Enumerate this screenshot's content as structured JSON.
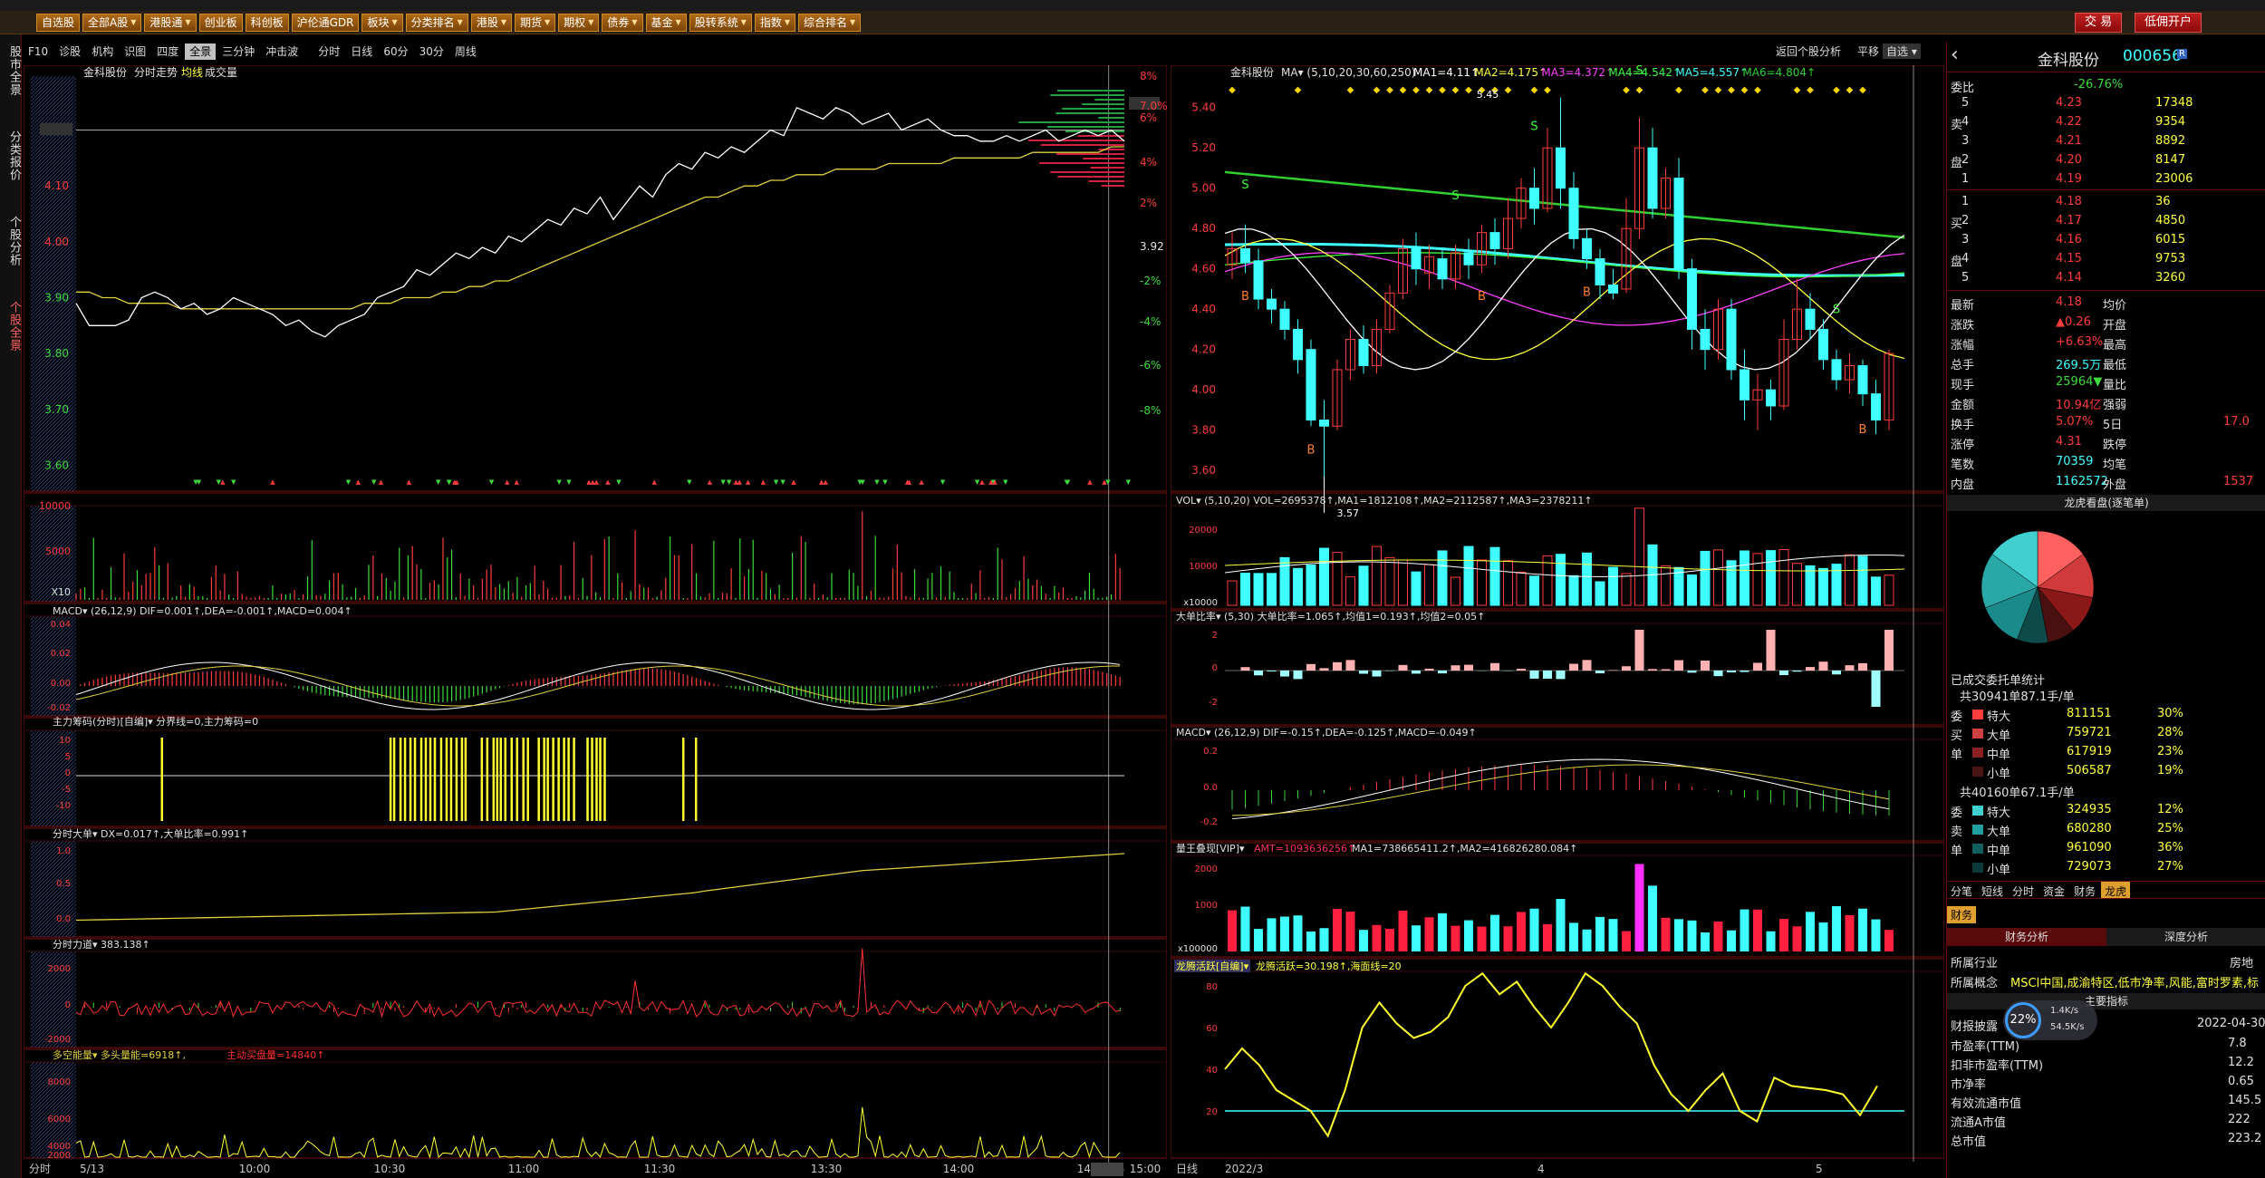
{
  "menu": {
    "items": [
      "自选股",
      "全部A股",
      "港股通",
      "创业板",
      "科创板",
      "沪伦通GDR",
      "板块",
      "分类排名",
      "港股",
      "期货",
      "期权",
      "债券",
      "基金",
      "股转系统",
      "指数",
      "综合排名"
    ],
    "withArrow": [
      false,
      true,
      true,
      false,
      false,
      false,
      true,
      true,
      true,
      true,
      true,
      true,
      true,
      true,
      true,
      true
    ],
    "trade": "交 易",
    "account": "低佣开户"
  },
  "lefttabs": [
    "股市全景",
    "分类报价",
    "个股分析",
    "个股全景"
  ],
  "subbar": {
    "items": [
      "F10",
      "诊股",
      "机构",
      "识图",
      "四度",
      "全景",
      "三分钟",
      "冲击波",
      "分时",
      "日线",
      "60分",
      "30分",
      "周线"
    ],
    "right_link": "返回个股分析",
    "right_b": "平移",
    "right_c": "自选"
  },
  "intraday": {
    "title": "金科股份",
    "mode": "分时走势",
    "avg": "均线",
    "vol": "成交量",
    "price_ticks": [
      "4.20",
      "4.10",
      "4.00",
      "3.90",
      "3.80",
      "3.70",
      "3.60"
    ],
    "pct_ticks": [
      "8%",
      "7.0%",
      "6%",
      "4%",
      "2%",
      "3.92",
      "-2%",
      "-4%",
      "-6%",
      "-8%"
    ],
    "price_line": [
      3.89,
      3.85,
      3.85,
      3.85,
      3.86,
      3.9,
      3.91,
      3.9,
      3.88,
      3.89,
      3.87,
      3.88,
      3.9,
      3.89,
      3.88,
      3.87,
      3.85,
      3.86,
      3.84,
      3.83,
      3.85,
      3.86,
      3.87,
      3.9,
      3.91,
      3.92,
      3.95,
      3.94,
      3.96,
      3.98,
      3.97,
      3.99,
      3.98,
      4.01,
      4.0,
      4.02,
      4.04,
      4.03,
      4.06,
      4.05,
      4.08,
      4.04,
      4.07,
      4.1,
      4.08,
      4.12,
      4.14,
      4.13,
      4.16,
      4.15,
      4.17,
      4.16,
      4.18,
      4.2,
      4.19,
      4.24,
      4.23,
      4.22,
      4.24,
      4.23,
      4.21,
      4.22,
      4.23,
      4.2,
      4.21,
      4.22,
      4.2,
      4.19,
      4.19,
      4.18,
      4.18,
      4.19,
      4.18,
      4.19,
      4.2,
      4.18,
      4.19,
      4.2,
      4.19,
      4.2,
      4.18
    ],
    "avg_line": [
      3.91,
      3.91,
      3.9,
      3.9,
      3.89,
      3.89,
      3.89,
      3.89,
      3.88,
      3.88,
      3.88,
      3.88,
      3.88,
      3.88,
      3.88,
      3.88,
      3.88,
      3.88,
      3.88,
      3.88,
      3.88,
      3.88,
      3.89,
      3.89,
      3.89,
      3.9,
      3.9,
      3.9,
      3.91,
      3.91,
      3.92,
      3.92,
      3.93,
      3.93,
      3.94,
      3.95,
      3.96,
      3.97,
      3.98,
      3.99,
      4.0,
      4.01,
      4.02,
      4.03,
      4.04,
      4.05,
      4.06,
      4.07,
      4.08,
      4.08,
      4.09,
      4.1,
      4.1,
      4.11,
      4.11,
      4.12,
      4.12,
      4.12,
      4.13,
      4.13,
      4.13,
      4.13,
      4.14,
      4.14,
      4.14,
      4.14,
      4.14,
      4.15,
      4.15,
      4.15,
      4.15,
      4.15,
      4.15,
      4.16,
      4.16,
      4.16,
      4.16,
      4.16,
      4.16,
      4.17,
      4.17
    ],
    "cur_price": "4.20",
    "vol_ticks": [
      "10000",
      "5000",
      "X10"
    ],
    "macd_label": "MACD▾  (26,12,9)  DIF=0.001↑,DEA=-0.001↑,MACD=0.004↑",
    "macd_ticks": [
      "0.04",
      "0.02",
      "0.00",
      "-0.02"
    ],
    "zlcm_label": "主力筹码(分时)[自编]▾  分界线=0,主力筹码=0",
    "zlcm_ticks": [
      "10",
      "5",
      "0",
      "-5",
      "-10"
    ],
    "dd_label": "分时大单▾  DX=0.017↑,大单比率=0.991↑",
    "dd_ticks": [
      "1.0",
      "0.5",
      "0.0"
    ],
    "ld_label": "分时力道▾  383.138↑",
    "ld_ticks": [
      "2000",
      "0",
      "-2000"
    ],
    "dk_label": "多空能量▾  多头量能=6918↑,",
    "dk_label2": "主动买盘量=14840↑",
    "dk_ticks": [
      "8000",
      "6000",
      "4000",
      "2000"
    ],
    "time_axis": [
      "5/13",
      "10:00",
      "10:30",
      "11:00",
      "11:30",
      "13:30",
      "14:00",
      "14:30",
      "14:53",
      "15:00"
    ],
    "bottom_left": "分时"
  },
  "kline": {
    "title": "金科股份",
    "ma_label": "MA▾  (5,10,20,30,60,250)",
    "ma_values": [
      "MA1=4.11↑",
      "MA2=4.175↑",
      "MA3=4.372↑",
      "MA4=4.542↑",
      "MA5=4.557↑",
      "MA6=4.804↑"
    ],
    "ma_colors": [
      "#ffffff",
      "#ffff40",
      "#ff40ff",
      "#40ff40",
      "#40ffff",
      "#30d030"
    ],
    "price_ticks": [
      "5.40",
      "5.20",
      "5.00",
      "4.80",
      "4.60",
      "4.40",
      "4.20",
      "4.00",
      "3.80",
      "3.60"
    ],
    "high_label": "5.45",
    "low_label": "3.57",
    "candles": [
      [
        4.62,
        4.7,
        4.55,
        4.78
      ],
      [
        4.7,
        4.63,
        4.58,
        4.82
      ],
      [
        4.64,
        4.45,
        4.4,
        4.7
      ],
      [
        4.45,
        4.4,
        4.33,
        4.5
      ],
      [
        4.4,
        4.3,
        4.25,
        4.44
      ],
      [
        4.3,
        4.15,
        4.08,
        4.35
      ],
      [
        4.2,
        3.85,
        3.82,
        4.25
      ],
      [
        3.85,
        3.82,
        3.57,
        3.95
      ],
      [
        3.82,
        4.1,
        3.8,
        4.15
      ],
      [
        4.1,
        4.25,
        4.05,
        4.3
      ],
      [
        4.25,
        4.12,
        4.08,
        4.32
      ],
      [
        4.12,
        4.3,
        4.08,
        4.35
      ],
      [
        4.3,
        4.48,
        4.28,
        4.52
      ],
      [
        4.48,
        4.7,
        4.45,
        4.75
      ],
      [
        4.7,
        4.6,
        4.52,
        4.78
      ],
      [
        4.58,
        4.66,
        4.5,
        4.72
      ],
      [
        4.65,
        4.55,
        4.5,
        4.7
      ],
      [
        4.55,
        4.68,
        4.5,
        4.72
      ],
      [
        4.68,
        4.62,
        4.55,
        4.75
      ],
      [
        4.62,
        4.78,
        4.58,
        4.82
      ],
      [
        4.78,
        4.7,
        4.62,
        4.85
      ],
      [
        4.7,
        4.85,
        4.65,
        4.95
      ],
      [
        4.85,
        5.0,
        4.8,
        5.05
      ],
      [
        5.0,
        4.9,
        4.82,
        5.1
      ],
      [
        4.9,
        5.2,
        4.88,
        5.3
      ],
      [
        5.2,
        5.0,
        4.9,
        5.45
      ],
      [
        5.0,
        4.75,
        4.7,
        5.08
      ],
      [
        4.75,
        4.65,
        4.6,
        4.8
      ],
      [
        4.65,
        4.52,
        4.45,
        4.7
      ],
      [
        4.52,
        4.48,
        4.45,
        4.6
      ],
      [
        4.5,
        4.8,
        4.48,
        4.95
      ],
      [
        4.8,
        5.2,
        4.75,
        5.35
      ],
      [
        5.2,
        4.9,
        4.85,
        5.3
      ],
      [
        4.9,
        5.05,
        4.85,
        5.1
      ],
      [
        5.05,
        4.6,
        4.55,
        5.15
      ],
      [
        4.6,
        4.3,
        4.2,
        4.65
      ],
      [
        4.3,
        4.2,
        4.1,
        4.4
      ],
      [
        4.2,
        4.4,
        4.15,
        4.45
      ],
      [
        4.4,
        4.1,
        4.05,
        4.45
      ],
      [
        4.1,
        3.95,
        3.85,
        4.2
      ],
      [
        3.95,
        4.0,
        3.8,
        4.08
      ],
      [
        4.0,
        3.92,
        3.85,
        4.05
      ],
      [
        3.92,
        4.25,
        3.9,
        4.35
      ],
      [
        4.25,
        4.4,
        4.2,
        4.55
      ],
      [
        4.4,
        4.3,
        4.25,
        4.48
      ],
      [
        4.3,
        4.15,
        4.1,
        4.35
      ],
      [
        4.15,
        4.05,
        4.0,
        4.2
      ],
      [
        4.05,
        4.12,
        3.98,
        4.18
      ],
      [
        4.12,
        3.98,
        3.92,
        4.15
      ],
      [
        3.98,
        3.85,
        3.78,
        4.05
      ],
      [
        3.85,
        4.18,
        3.8,
        4.2
      ]
    ],
    "vol_label": "VOL▾  (5,10,20)  VOL=2695378↑,MA1=1812108↑,MA2=2112587↑,MA3=2378211↑",
    "vol_ticks": [
      "20000",
      "10000",
      "x10000"
    ],
    "ddbl_label": "大单比率▾  (5,30)  大单比率=1.065↑,均值1=0.193↑,均值2=0.05↑",
    "ddbl_ticks": [
      "2",
      "0",
      "-2"
    ],
    "macd_label": "MACD▾  (26,12,9)  DIF=-0.15↑,DEA=-0.125↑,MACD=-0.049↑",
    "macd_ticks": [
      "0.2",
      "0.0",
      "-0.2"
    ],
    "lwdx_label": "量王叠现[VIP]▾",
    "lwdx_amt": "AMT=1093636256↑",
    "lwdx_rest": "MA1=738665411.2↑,MA2=416826280.084↑",
    "lwdx_ticks": [
      "2000",
      "1000",
      "x100000"
    ],
    "lthy_label": "龙腾活跃[自编]▾",
    "lthy_rest": "龙腾活跃=30.198↑,海面线=20",
    "lthy_ticks": [
      "80",
      "60",
      "40",
      "20"
    ],
    "lthy_values": [
      40,
      50,
      42,
      30,
      25,
      20,
      8,
      30,
      60,
      72,
      62,
      55,
      58,
      65,
      80,
      86,
      76,
      82,
      70,
      60,
      72,
      86,
      80,
      70,
      62,
      42,
      28,
      20,
      30,
      38,
      20,
      15,
      36,
      32,
      31,
      30,
      28,
      18,
      32
    ],
    "time_axis": [
      "2022/3",
      "4",
      "5"
    ],
    "bottom_left": "日线"
  },
  "quote": {
    "name": "金科股份",
    "code": "000656",
    "wb_label": "委比",
    "wb_val": "-26.76%",
    "wb_right": "",
    "sell": [
      [
        "卖5",
        "4.23",
        "17348"
      ],
      [
        "卖4",
        "4.22",
        "9354"
      ],
      [
        "卖3",
        "4.21",
        "8892"
      ],
      [
        "卖2",
        "4.20",
        "8147"
      ],
      [
        "卖1",
        "4.19",
        "23006"
      ]
    ],
    "buy": [
      [
        "买1",
        "4.18",
        "36"
      ],
      [
        "买2",
        "4.17",
        "4850"
      ],
      [
        "买3",
        "4.16",
        "6015"
      ],
      [
        "买4",
        "4.15",
        "9753"
      ],
      [
        "买5",
        "4.14",
        "3260"
      ]
    ],
    "stats": [
      [
        "最新",
        "4.18",
        "均价",
        ""
      ],
      [
        "涨跌",
        "▲0.26",
        "开盘",
        ""
      ],
      [
        "涨幅",
        "+6.63%",
        "最高",
        ""
      ],
      [
        "总手",
        "269.5万",
        "最低",
        ""
      ],
      [
        "现手",
        "25964▼",
        "量比",
        ""
      ],
      [
        "金额",
        "10.94亿",
        "强弱",
        ""
      ],
      [
        "换手",
        "5.07%",
        "5日",
        "17.0"
      ],
      [
        "涨停",
        "4.31",
        "跌停",
        ""
      ],
      [
        "笔数",
        "70359",
        "均笔",
        ""
      ],
      [
        "内盘",
        "1162572",
        "外盘",
        "1537"
      ]
    ],
    "pie_title": "龙虎看盘(逐笔单)",
    "pie_colors": [
      "#ff6060",
      "#d03a3a",
      "#8a1818",
      "#4a0f0f",
      "#0f4a4a",
      "#1a8a8a",
      "#2aa8a8",
      "#40d0d0"
    ],
    "pie_values": [
      15,
      13,
      11,
      8,
      9,
      13,
      16,
      15
    ],
    "deal_title": "已成交委托单统计",
    "buy_total": "共30941单87.1手/单",
    "buy_rows": [
      [
        "特大",
        "811151",
        "30%",
        "#ff3c3c"
      ],
      [
        "大单",
        "759721",
        "28%",
        "#d04040"
      ],
      [
        "中单",
        "617919",
        "23%",
        "#8a2020"
      ],
      [
        "小单",
        "506587",
        "19%",
        "#4a1515"
      ]
    ],
    "buy_side": [
      "委",
      "买",
      "单"
    ],
    "sell_total": "共40160单67.1手/单",
    "sell_rows": [
      [
        "特大",
        "324935",
        "12%",
        "#40d0d0"
      ],
      [
        "大单",
        "680280",
        "25%",
        "#20a0a0"
      ],
      [
        "中单",
        "961090",
        "36%",
        "#106060"
      ],
      [
        "小单",
        "729073",
        "27%",
        "#0a3a3a"
      ]
    ],
    "sell_side": [
      "委",
      "卖",
      "单"
    ],
    "tabs": [
      "分笔",
      "短线",
      "分时",
      "资金",
      "财务",
      "龙虎"
    ],
    "fin_tab": "财务",
    "fin_subtabs": [
      "财务分析",
      "深度分析"
    ],
    "industry_label": "所属行业",
    "industry_val": "房地",
    "concept_label": "所属概念",
    "concept_val": "MSCI中国,成渝特区,低市净率,风能,富时罗素,标",
    "main_label": "主要指标",
    "report_label": "财报披露",
    "report_val": "2022-04-30",
    "fin_rows": [
      [
        "市盈率(TTM)",
        "7.8"
      ],
      [
        "扣非市盈率(TTM)",
        "12.2"
      ],
      [
        "市净率",
        "0.65"
      ],
      [
        "有效流通市值",
        "145.5"
      ],
      [
        "流通A市值",
        "222"
      ],
      [
        "总市值",
        "223.2"
      ]
    ],
    "speed_pct": "22%",
    "speed_up": "1.4K/s",
    "speed_down": "54.5K/s"
  }
}
